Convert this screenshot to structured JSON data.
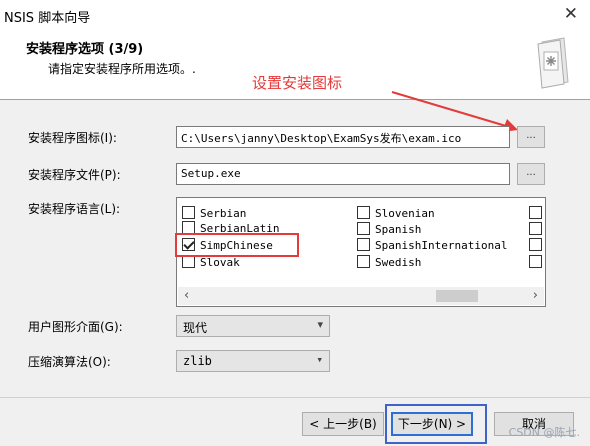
{
  "window": {
    "title": "NSIS 脚本向导",
    "close_glyph": "✕"
  },
  "header": {
    "title": "安装程序选项 (3/9)",
    "subtitle": "请指定安装程序所用选项。.",
    "annotation": "设置安装图标"
  },
  "form": {
    "icon_label": "安装程序图标(I):",
    "icon_value": "C:\\Users\\janny\\Desktop\\ExamSys发布\\exam.ico",
    "file_label": "安装程序文件(P):",
    "file_value": "Setup.exe",
    "browse_label": "...",
    "language_label": "安装程序语言(L):",
    "languages_col1": [
      "Serbian",
      "SerbianLatin",
      "SimpChinese",
      "Slovak"
    ],
    "languages_col2": [
      "Slovenian",
      "Spanish",
      "SpanishInternational",
      "Swedish"
    ],
    "checked_language": "SimpChinese",
    "ui_label": "用户图形介面(G):",
    "ui_value": "现代",
    "compress_label": "压缩演算法(O):",
    "compress_value": "zlib"
  },
  "buttons": {
    "back": "< 上一步(B)",
    "next": "下一步(N) >",
    "cancel": "取消"
  },
  "watermark": "CSDN @陈七."
}
